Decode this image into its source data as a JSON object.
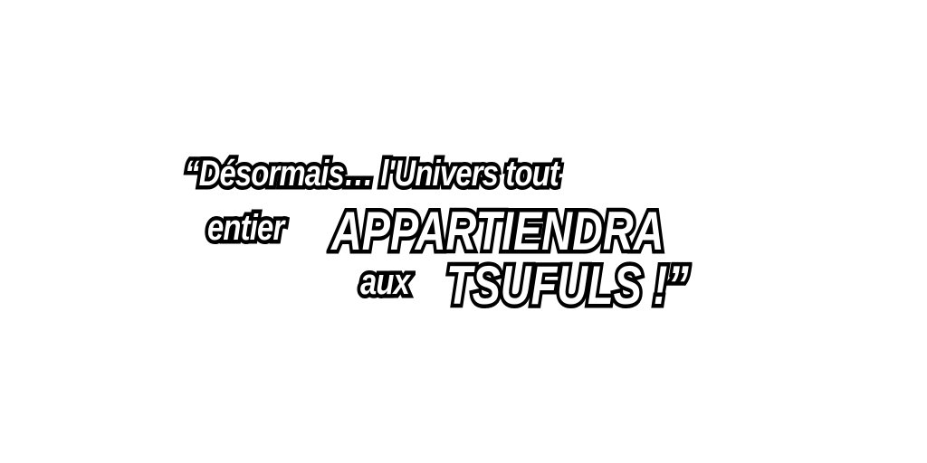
{
  "caption": {
    "line1": "“Désormais… l'Univers tout",
    "line2_small": "entier",
    "line2_big": "APPARTIENDRA",
    "line3_small": "aux",
    "line3_big": "TSUFULS !”"
  },
  "colors": {
    "background": "#ffffff",
    "text_fill": "#ffffff",
    "text_outline": "#000000"
  }
}
